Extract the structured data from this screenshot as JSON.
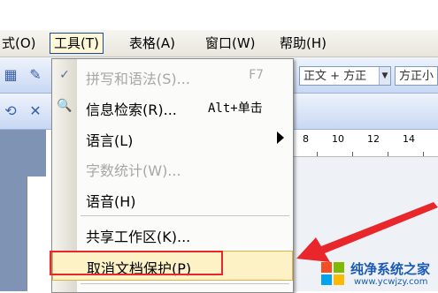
{
  "menubar": {
    "items": [
      {
        "label": "式(O)"
      },
      {
        "label": "工具(T)"
      },
      {
        "label": "表格(A)"
      },
      {
        "label": "窗口(W)"
      },
      {
        "label": "帮助(H)"
      }
    ]
  },
  "toolbar": {
    "style_combo": "正文 + 方正",
    "font_combo": "方正小"
  },
  "ruler": {
    "ticks": [
      "8",
      "10",
      "12",
      "14"
    ]
  },
  "tools_menu": {
    "items": [
      {
        "label": "拼写和语法(S)...",
        "shortcut": "F7",
        "enabled": false,
        "icon": "spellcheck-icon"
      },
      {
        "label": "信息检索(R)...",
        "shortcut": "Alt+单击",
        "enabled": true,
        "icon": "research-icon"
      },
      {
        "label": "语言(L)",
        "shortcut": "",
        "enabled": true,
        "has_submenu": true
      },
      {
        "label": "字数统计(W)...",
        "shortcut": "",
        "enabled": false
      },
      {
        "label": "语音(H)",
        "shortcut": "",
        "enabled": true
      },
      {
        "label": "共享工作区(K)...",
        "shortcut": "",
        "enabled": true
      },
      {
        "label": "取消文档保护(P)",
        "shortcut": "",
        "enabled": true,
        "highlighted": true
      }
    ]
  },
  "watermark": {
    "title": "纯净系统之家",
    "url": "www.ycwjzy.com"
  },
  "colors": {
    "highlight_box": "#e8262b",
    "arrow": "#e8262b",
    "menu_highlight": "#fdf1c6"
  }
}
